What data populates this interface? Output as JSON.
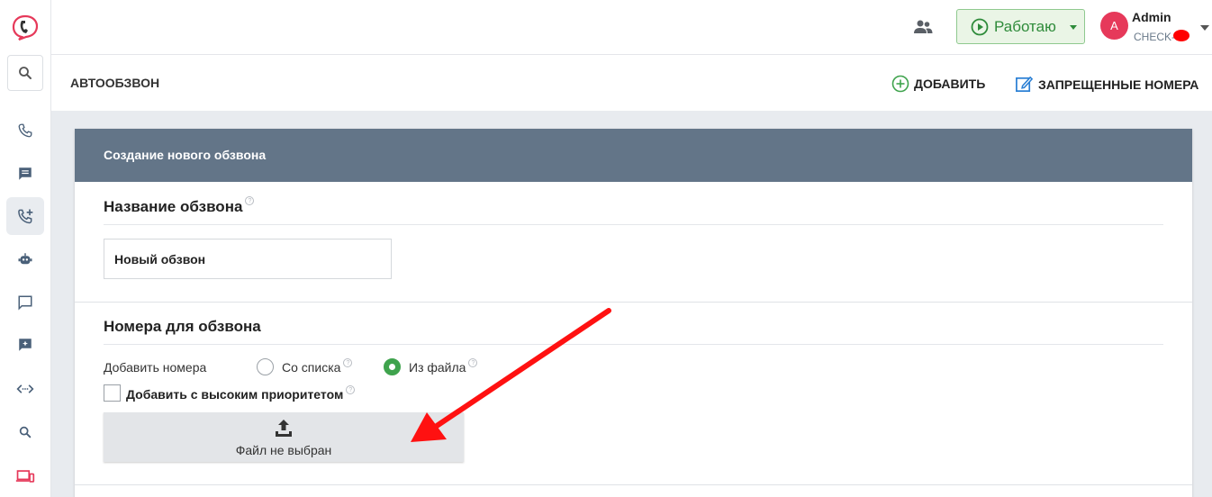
{
  "topbar": {
    "status_label": "Работаю",
    "user": {
      "avatar_letter": "A",
      "name": "Admin",
      "account": "CHECK-"
    }
  },
  "section": {
    "title": "АВТООБЗВОН",
    "add_label": "ДОБАВИТЬ",
    "banned_label": "ЗАПРЕЩЕННЫЕ НОМЕРА"
  },
  "card": {
    "header": "Создание нового обзвона",
    "name_block": {
      "title": "Название обзвона",
      "input_value": "Новый обзвон"
    },
    "numbers_block": {
      "title": "Номера для обзвона",
      "add_numbers_label": "Добавить номера",
      "option_list": "Со списка",
      "option_file": "Из файла",
      "selected_option": "Из файла",
      "priority_label": "Добавить с высоким приоритетом",
      "upload_text": "Файл не выбран"
    }
  },
  "colors": {
    "header_bg": "#637588",
    "accent_green": "#3fa34d",
    "avatar_red": "#e6395a",
    "arrow_red": "#ff0000"
  },
  "icons": [
    "logo-icon",
    "search-icon",
    "phone-icon",
    "chat-icon",
    "call-add-icon",
    "robot-icon",
    "message-icon",
    "ai-message-icon",
    "code-icon",
    "search-small-icon",
    "devices-icon",
    "team-icon",
    "play-circle-icon",
    "plus-circle-icon",
    "edit-icon",
    "upload-icon"
  ]
}
